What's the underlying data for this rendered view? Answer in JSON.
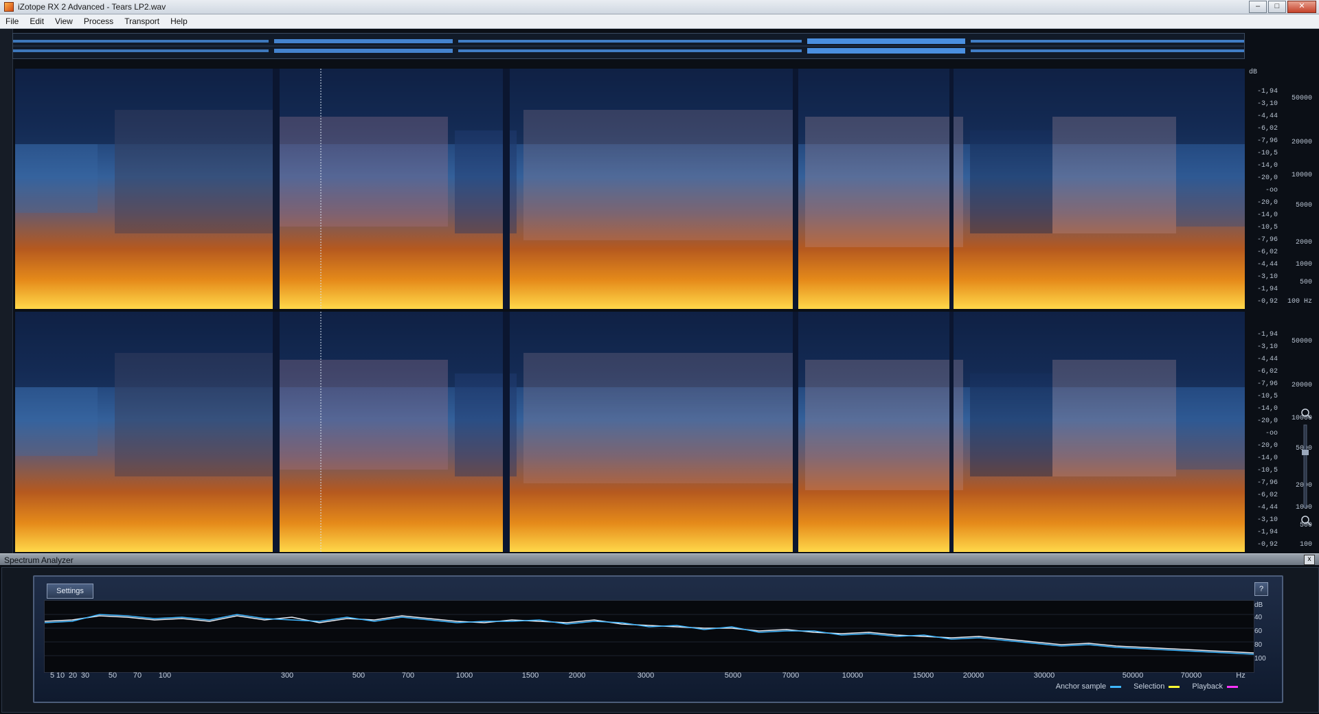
{
  "window": {
    "title": "iZotope RX 2 Advanced - Tears LP2.wav",
    "buttons": {
      "minimize": "–",
      "maximize": "□",
      "close": "✕"
    }
  },
  "menu": [
    "File",
    "Edit",
    "View",
    "Process",
    "Transport",
    "Help"
  ],
  "spectrogram": {
    "db_ticks": [
      "dB",
      "-1,94",
      "-3,10",
      "-4,44",
      "-6,02",
      "-7,96",
      "-10,5",
      "-14,0",
      "-20,0",
      "-oo",
      "-20,0",
      "-14,0",
      "-10,5",
      "-7,96",
      "-6,02",
      "-4,44",
      "-3,10",
      "-1,94",
      "-0,92"
    ],
    "hz_ticks_ch1": [
      "50000",
      "20000",
      "10000",
      "5000",
      "2000",
      "1000",
      "500",
      "100 Hz"
    ],
    "hz_ticks_ch2": [
      "50000",
      "20000",
      "10000",
      "5000",
      "2000",
      "1000",
      "500",
      "100"
    ],
    "db_ticks_ch2": [
      "-1,94",
      "-3,10",
      "-4,44",
      "-6,02",
      "-7,96",
      "-10,5",
      "-14,0",
      "-20,0",
      "-oo",
      "-20,0",
      "-14,0",
      "-10,5",
      "-7,96",
      "-6,02",
      "-4,44",
      "-3,10",
      "-1,94",
      "-0,92"
    ]
  },
  "analyzer": {
    "title": "Spectrum Analyzer",
    "close": "x",
    "settings_label": "Settings",
    "help_label": "?",
    "x_labels": [
      "5",
      "10",
      "20",
      "30",
      "50",
      "70",
      "100",
      "300",
      "500",
      "700",
      "1000",
      "1500",
      "2000",
      "3000",
      "5000",
      "7000",
      "10000",
      "15000",
      "20000",
      "30000",
      "50000",
      "70000",
      "Hz"
    ],
    "y_labels": [
      "dB",
      "40",
      "60",
      "80",
      "100"
    ],
    "legend": [
      {
        "label": "Anchor sample",
        "color": "#3fb6ff"
      },
      {
        "label": "Selection",
        "color": "#ffff33"
      },
      {
        "label": "Playback",
        "color": "#ff33ff"
      }
    ]
  }
}
